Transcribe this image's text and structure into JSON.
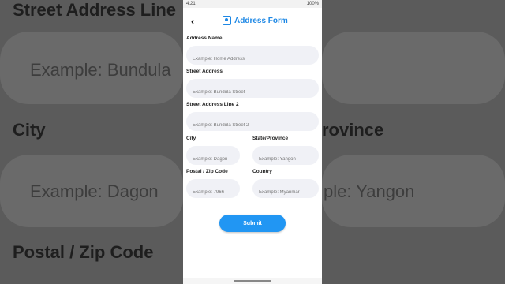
{
  "status": {
    "time": "4:21",
    "battery": "100%"
  },
  "header": {
    "title": "Address Form"
  },
  "form": {
    "address_name": {
      "label": "Address Name",
      "placeholder": "Example: Home Address"
    },
    "street_address": {
      "label": "Street Address",
      "placeholder": "Example: Bundula Street"
    },
    "street_address_2": {
      "label": "Street Address Line 2",
      "placeholder": "Example: Bundula Street 2"
    },
    "city": {
      "label": "City",
      "placeholder": "Example: Dagon"
    },
    "state": {
      "label": "State/Province",
      "placeholder": "Example: Yangon"
    },
    "postal": {
      "label": "Postal / Zip Code",
      "placeholder": "Example: 7966"
    },
    "country": {
      "label": "Country",
      "placeholder": "Example: Myanmar"
    },
    "submit_label": "Submit"
  },
  "background": {
    "label_top": "Street Address Line",
    "placeholder_top": "Example: Bundula",
    "label_city": "City",
    "label_province": "rovince",
    "placeholder_city": "Example: Dagon",
    "placeholder_yangon": "ple: Yangon",
    "label_postal": "Postal / Zip Code"
  },
  "colors": {
    "accent": "#1e88e5",
    "button": "#2196f3",
    "field_bg": "#f0f1f6"
  }
}
